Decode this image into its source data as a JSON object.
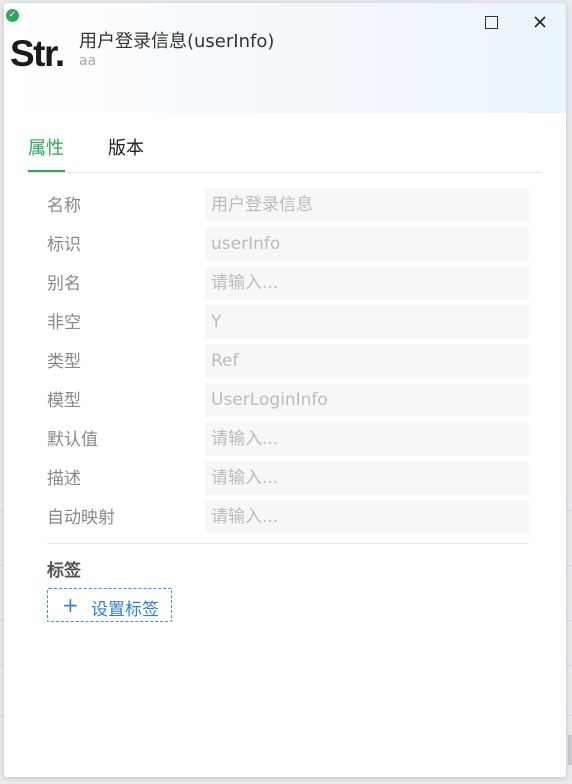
{
  "header": {
    "logo_text": "Str.",
    "title": "用户登录信息(userInfo)",
    "subtitle": "aa",
    "status_icon": "check-circle-icon",
    "status_color": "#2fa65a"
  },
  "window_controls": {
    "maximize_icon": "maximize-icon",
    "close_icon": "close-icon"
  },
  "tabs": [
    {
      "label": "属性",
      "active": true
    },
    {
      "label": "版本",
      "active": false
    }
  ],
  "form": {
    "fields": [
      {
        "label": "名称",
        "value": "用户登录信息"
      },
      {
        "label": "标识",
        "value": "userInfo"
      },
      {
        "label": "别名",
        "value": "请输入..."
      },
      {
        "label": "非空",
        "value": "Y"
      },
      {
        "label": "类型",
        "value": "Ref"
      },
      {
        "label": "模型",
        "value": "UserLoginInfo"
      },
      {
        "label": "默认值",
        "value": "请输入..."
      },
      {
        "label": "描述",
        "value": "请输入..."
      },
      {
        "label": "自动映射",
        "value": "请输入..."
      }
    ]
  },
  "tags": {
    "title": "标签",
    "button_label": "设置标签",
    "button_icon": "plus-icon"
  },
  "colors": {
    "accent": "#2fa65a",
    "link": "#2f7fd8"
  }
}
